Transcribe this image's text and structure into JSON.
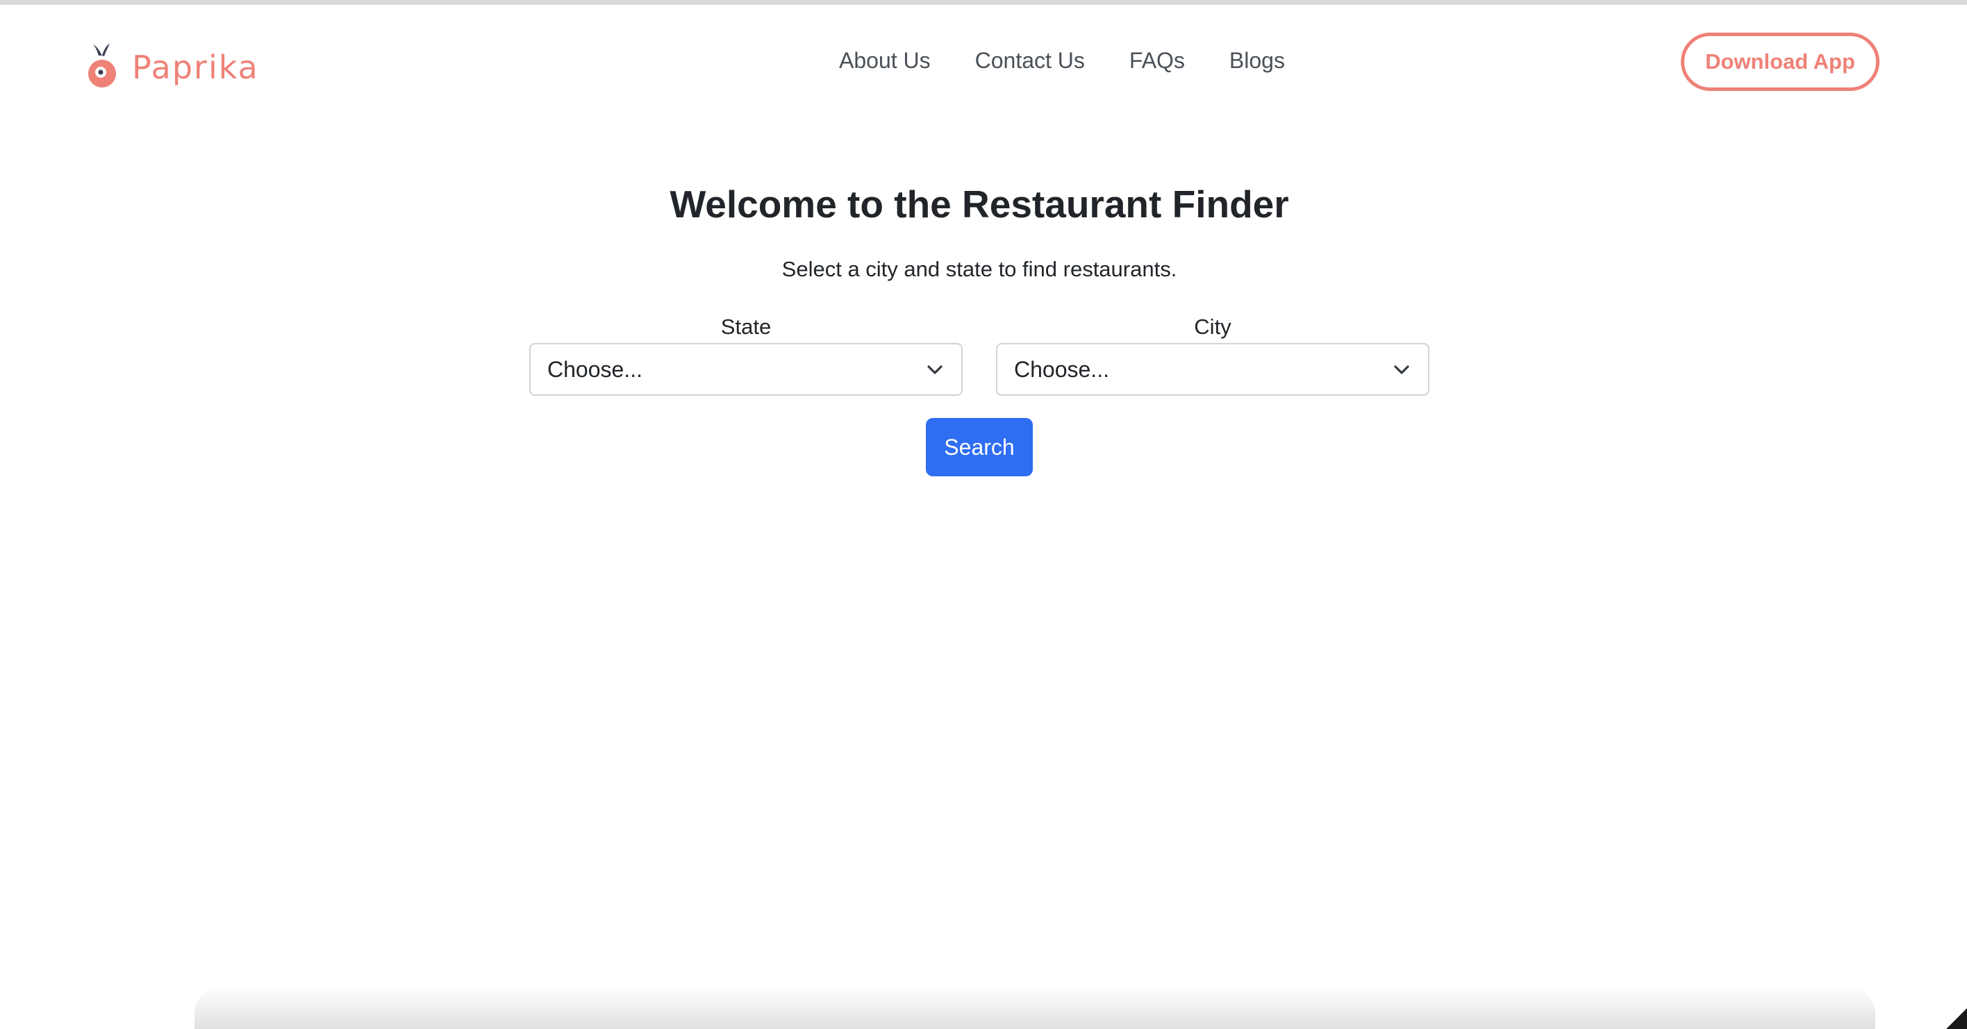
{
  "brand": {
    "name": "Paprika",
    "accent_color": "#ef8177",
    "logo_icon": "paprika-icon"
  },
  "nav": {
    "links": [
      "About Us",
      "Contact Us",
      "FAQs",
      "Blogs"
    ],
    "cta_label": "Download App"
  },
  "hero": {
    "title": "Welcome to the Restaurant Finder",
    "subtitle": "Select a city and state to find restaurants."
  },
  "form": {
    "state": {
      "label": "State",
      "value": "Choose..."
    },
    "city": {
      "label": "City",
      "value": "Choose..."
    },
    "search_label": "Search",
    "search_color": "#2f6ef2",
    "dropdown_icon": "chevron-down-icon"
  }
}
